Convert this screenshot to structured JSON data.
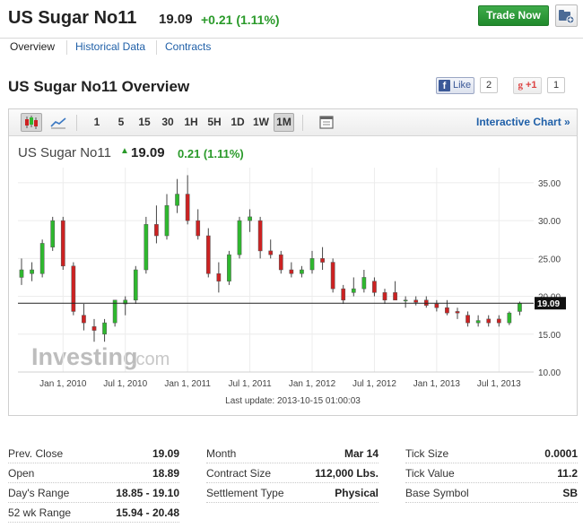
{
  "header": {
    "title": "US Sugar No11",
    "price": "19.09",
    "change": "+0.21 (1.11%)",
    "trade_label": "Trade Now",
    "accent_green": "#2a9a2a"
  },
  "tabs": [
    {
      "label": "Overview",
      "active": true
    },
    {
      "label": "Historical Data",
      "active": false
    },
    {
      "label": "Contracts",
      "active": false
    }
  ],
  "overview": {
    "title": "US Sugar No11 Overview",
    "like_label": "Like",
    "like_count": "2",
    "gplus_label": "+1",
    "gplus_count": "1"
  },
  "toolbar": {
    "intervals": [
      "1",
      "5",
      "15",
      "30",
      "1H",
      "5H",
      "1D",
      "1W",
      "1M"
    ],
    "active_interval": "1M",
    "interactive_label": "Interactive Chart »"
  },
  "chart_header": {
    "symbol": "US Sugar No11",
    "price": "19.09",
    "change": "0.21 (1.11%)"
  },
  "chart_data": {
    "type": "candlestick",
    "x_tick_labels": [
      "Jan 1, 2010",
      "Jul 1, 2010",
      "Jan 1, 2011",
      "Jul 1, 2011",
      "Jan 1, 2012",
      "Jul 1, 2012",
      "Jan 1, 2013",
      "Jul 1, 2013"
    ],
    "x_range": [
      "2009-09",
      "2013-10"
    ],
    "y_tick_labels": [
      "10.00",
      "15.00",
      "20.00",
      "25.00",
      "30.00",
      "35.00"
    ],
    "y_ticks": [
      10,
      15,
      20,
      25,
      30,
      35
    ],
    "ylim": [
      10,
      37
    ],
    "current_price_line": 19.09,
    "current_price_label": "19.09",
    "watermark": "Investing",
    "watermark_suffix": ".com",
    "up_color": "#2eb82e",
    "down_color": "#cc2222",
    "candles": [
      {
        "date": "2009-09",
        "open": 22.5,
        "high": 25.0,
        "low": 21.5,
        "close": 23.5
      },
      {
        "date": "2009-10",
        "open": 23.0,
        "high": 24.5,
        "low": 22.0,
        "close": 23.5
      },
      {
        "date": "2009-11",
        "open": 23.0,
        "high": 27.5,
        "low": 22.5,
        "close": 27.0
      },
      {
        "date": "2009-12",
        "open": 26.5,
        "high": 30.5,
        "low": 26.0,
        "close": 30.0
      },
      {
        "date": "2010-01",
        "open": 30.0,
        "high": 30.5,
        "low": 23.5,
        "close": 24.0
      },
      {
        "date": "2010-02",
        "open": 24.0,
        "high": 24.5,
        "low": 17.5,
        "close": 18.0
      },
      {
        "date": "2010-03",
        "open": 17.5,
        "high": 19.0,
        "low": 15.5,
        "close": 16.5
      },
      {
        "date": "2010-04",
        "open": 16.0,
        "high": 17.0,
        "low": 14.0,
        "close": 15.5
      },
      {
        "date": "2010-05",
        "open": 15.0,
        "high": 17.0,
        "low": 14.0,
        "close": 16.5
      },
      {
        "date": "2010-06",
        "open": 16.5,
        "high": 19.5,
        "low": 16.0,
        "close": 19.5
      },
      {
        "date": "2010-07",
        "open": 19.0,
        "high": 20.0,
        "low": 17.5,
        "close": 19.5
      },
      {
        "date": "2010-08",
        "open": 19.5,
        "high": 24.0,
        "low": 19.0,
        "close": 23.5
      },
      {
        "date": "2010-09",
        "open": 23.5,
        "high": 30.5,
        "low": 23.0,
        "close": 29.5
      },
      {
        "date": "2010-10",
        "open": 29.5,
        "high": 32.0,
        "low": 27.0,
        "close": 28.0
      },
      {
        "date": "2010-11",
        "open": 28.0,
        "high": 33.5,
        "low": 27.5,
        "close": 32.0
      },
      {
        "date": "2010-12",
        "open": 32.0,
        "high": 35.5,
        "low": 31.0,
        "close": 33.5
      },
      {
        "date": "2011-01",
        "open": 33.5,
        "high": 36.0,
        "low": 29.5,
        "close": 30.0
      },
      {
        "date": "2011-02",
        "open": 30.0,
        "high": 31.5,
        "low": 27.5,
        "close": 28.0
      },
      {
        "date": "2011-03",
        "open": 28.0,
        "high": 29.0,
        "low": 22.5,
        "close": 23.0
      },
      {
        "date": "2011-04",
        "open": 23.0,
        "high": 24.5,
        "low": 20.5,
        "close": 22.0
      },
      {
        "date": "2011-05",
        "open": 22.0,
        "high": 26.0,
        "low": 21.5,
        "close": 25.5
      },
      {
        "date": "2011-06",
        "open": 25.5,
        "high": 30.5,
        "low": 25.0,
        "close": 30.0
      },
      {
        "date": "2011-07",
        "open": 30.0,
        "high": 31.5,
        "low": 28.5,
        "close": 30.5
      },
      {
        "date": "2011-08",
        "open": 30.0,
        "high": 30.5,
        "low": 25.0,
        "close": 26.0
      },
      {
        "date": "2011-09",
        "open": 26.0,
        "high": 27.5,
        "low": 25.0,
        "close": 25.5
      },
      {
        "date": "2011-10",
        "open": 25.5,
        "high": 26.0,
        "low": 23.0,
        "close": 23.5
      },
      {
        "date": "2011-11",
        "open": 23.5,
        "high": 24.5,
        "low": 22.5,
        "close": 23.0
      },
      {
        "date": "2011-12",
        "open": 23.0,
        "high": 24.0,
        "low": 22.5,
        "close": 23.5
      },
      {
        "date": "2012-01",
        "open": 23.5,
        "high": 26.0,
        "low": 23.0,
        "close": 25.0
      },
      {
        "date": "2012-02",
        "open": 25.0,
        "high": 26.5,
        "low": 23.5,
        "close": 24.5
      },
      {
        "date": "2012-03",
        "open": 24.5,
        "high": 25.0,
        "low": 20.5,
        "close": 21.0
      },
      {
        "date": "2012-04",
        "open": 21.0,
        "high": 21.5,
        "low": 19.0,
        "close": 19.5
      },
      {
        "date": "2012-05",
        "open": 20.5,
        "high": 22.5,
        "low": 20.0,
        "close": 21.0
      },
      {
        "date": "2012-06",
        "open": 21.0,
        "high": 23.5,
        "low": 20.5,
        "close": 22.5
      },
      {
        "date": "2012-07",
        "open": 22.0,
        "high": 22.5,
        "low": 20.0,
        "close": 20.5
      },
      {
        "date": "2012-08",
        "open": 20.5,
        "high": 21.0,
        "low": 19.0,
        "close": 19.5
      },
      {
        "date": "2012-09",
        "open": 20.5,
        "high": 22.0,
        "low": 19.5,
        "close": 19.5
      },
      {
        "date": "2012-10",
        "open": 19.5,
        "high": 20.0,
        "low": 18.5,
        "close": 19.5
      },
      {
        "date": "2012-11",
        "open": 19.5,
        "high": 20.0,
        "low": 18.8,
        "close": 19.2
      },
      {
        "date": "2012-12",
        "open": 19.5,
        "high": 20.0,
        "low": 18.5,
        "close": 18.8
      },
      {
        "date": "2013-01",
        "open": 19.0,
        "high": 19.5,
        "low": 18.0,
        "close": 18.5
      },
      {
        "date": "2013-02",
        "open": 18.5,
        "high": 19.5,
        "low": 17.5,
        "close": 17.8
      },
      {
        "date": "2013-03",
        "open": 18.0,
        "high": 18.5,
        "low": 17.0,
        "close": 17.8
      },
      {
        "date": "2013-04",
        "open": 17.5,
        "high": 18.0,
        "low": 16.0,
        "close": 16.5
      },
      {
        "date": "2013-05",
        "open": 16.5,
        "high": 17.5,
        "low": 16.0,
        "close": 16.8
      },
      {
        "date": "2013-06",
        "open": 17.0,
        "high": 17.5,
        "low": 16.0,
        "close": 16.5
      },
      {
        "date": "2013-07",
        "open": 17.0,
        "high": 17.5,
        "low": 16.0,
        "close": 16.5
      },
      {
        "date": "2013-08",
        "open": 16.5,
        "high": 18.0,
        "low": 16.2,
        "close": 17.8
      },
      {
        "date": "2013-09",
        "open": 18.0,
        "high": 19.3,
        "low": 17.5,
        "close": 19.09
      }
    ]
  },
  "last_update": "Last update: 2013-10-15 01:00:03",
  "stats": {
    "col1": [
      {
        "label": "Prev. Close",
        "value": "19.09"
      },
      {
        "label": "Open",
        "value": "18.89"
      },
      {
        "label": "Day's Range",
        "value": "18.85 - 19.10"
      },
      {
        "label": "52 wk Range",
        "value": "15.94 - 20.48"
      }
    ],
    "col2": [
      {
        "label": "Month",
        "value": "Mar 14"
      },
      {
        "label": "Contract Size",
        "value": "112,000 Lbs."
      },
      {
        "label": "Settlement Type",
        "value": "Physical"
      }
    ],
    "col3": [
      {
        "label": "Tick Size",
        "value": "0.0001"
      },
      {
        "label": "Tick Value",
        "value": "11.2"
      },
      {
        "label": "Base Symbol",
        "value": "SB"
      }
    ]
  }
}
